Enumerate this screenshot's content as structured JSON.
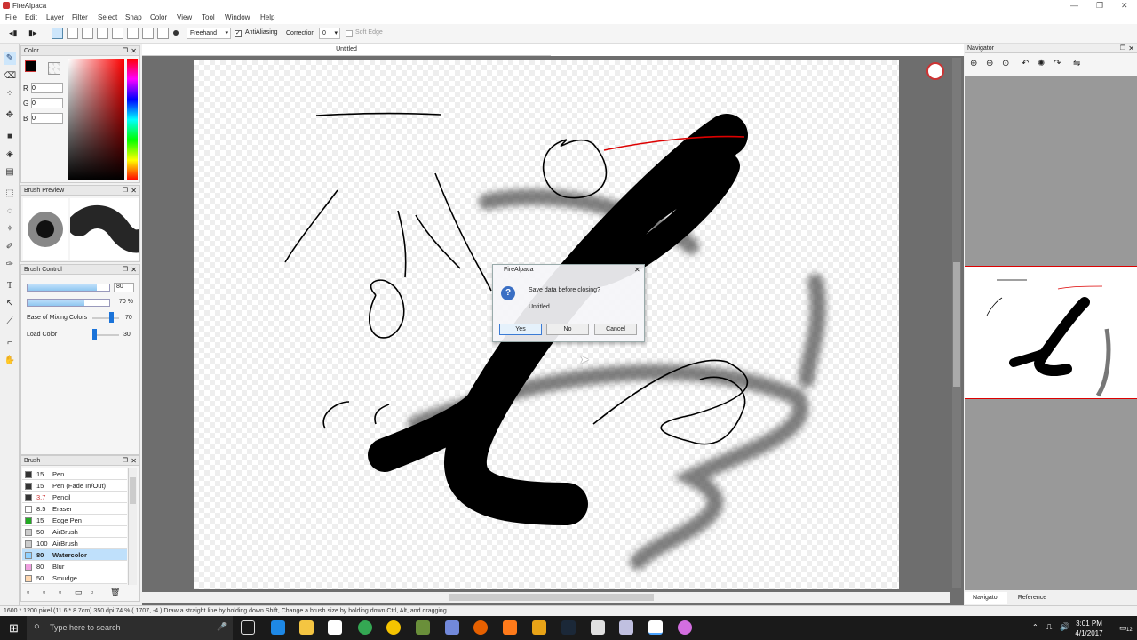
{
  "app": {
    "title": "FireAlpaca",
    "minimize": "—",
    "maximize": "❐",
    "close": "✕"
  },
  "menu": [
    "File",
    "Edit",
    "Layer",
    "Filter",
    "Select",
    "Snap",
    "Color",
    "View",
    "Tool",
    "Window",
    "Help"
  ],
  "toolbar": {
    "brush_mode": "Freehand",
    "antialiasing": "AntiAliasing",
    "correction_label": "Correction",
    "correction_value": "0",
    "soft_edge": "Soft Edge"
  },
  "document": {
    "tab": "Untitled"
  },
  "color_panel": {
    "title": "Color",
    "r_label": "R",
    "g_label": "G",
    "b_label": "B",
    "r": "0",
    "g": "0",
    "b": "0"
  },
  "brush_preview": {
    "title": "Brush Preview"
  },
  "brush_control": {
    "title": "Brush Control",
    "size": "80",
    "opacity": "70 %",
    "mixing_label": "Ease of Mixing Colors",
    "mixing_value": "70",
    "load_label": "Load Color",
    "load_value": "30"
  },
  "brush_panel": {
    "title": "Brush",
    "items": [
      {
        "size": "15",
        "name": "Pen",
        "color": "#333333"
      },
      {
        "size": "15",
        "name": "Pen (Fade In/Out)",
        "color": "#333333"
      },
      {
        "size": "3.7",
        "name": "Pencil",
        "color": "#333333"
      },
      {
        "size": "8.5",
        "name": "Eraser",
        "color": "#ffffff"
      },
      {
        "size": "15",
        "name": "Edge Pen",
        "color": "#22aa22"
      },
      {
        "size": "50",
        "name": "AirBrush",
        "color": "#cccccc"
      },
      {
        "size": "100",
        "name": "AirBrush",
        "color": "#cccccc"
      },
      {
        "size": "80",
        "name": "Watercolor",
        "color": "#8fd0ff"
      },
      {
        "size": "80",
        "name": "Blur",
        "color": "#f0a0e0"
      },
      {
        "size": "50",
        "name": "Smudge",
        "color": "#ffd8b0"
      }
    ]
  },
  "dialog": {
    "title": "FireAlpaca",
    "message": "Save data before closing?",
    "filename": "Untitled",
    "yes": "Yes",
    "no": "No",
    "cancel": "Cancel",
    "close": "✕"
  },
  "navigator": {
    "title": "Navigator",
    "tab_navigator": "Navigator",
    "tab_reference": "Reference"
  },
  "status": {
    "text": "1600 * 1200 pixel   (11.6 * 8.7cm)   350 dpi   74 %   ( 1707, -4 )   Draw a straight line by holding down Shift, Change a brush size by holding down Ctrl, Alt, and dragging"
  },
  "taskbar": {
    "search_placeholder": "Type here to search",
    "time": "3:01 PM",
    "date": "4/1/2017",
    "notifications": "12"
  },
  "colors": {
    "accent": "#0078d7",
    "selected_brush_bg": "#bfe0fb"
  }
}
